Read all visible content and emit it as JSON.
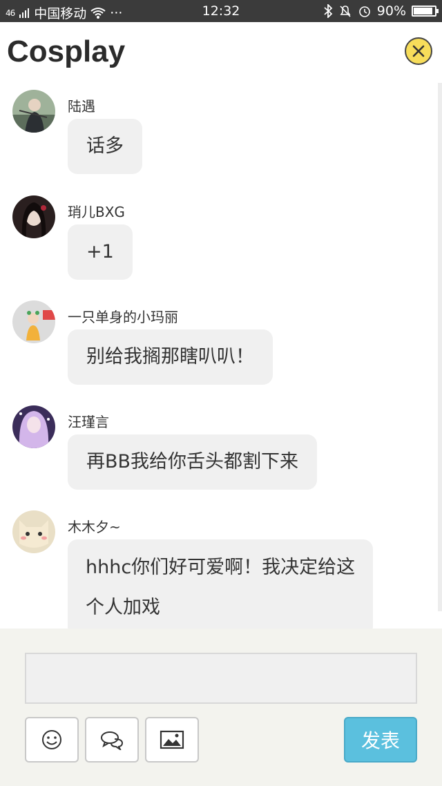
{
  "status_bar": {
    "network": "46",
    "carrier": "中国移动",
    "dots": "···",
    "time": "12:32",
    "battery": "90%",
    "battery_level": 0.9
  },
  "header": {
    "title": "Cosplay"
  },
  "messages": [
    {
      "user": "陆遇",
      "text": "话多",
      "avatar_color": "#6d7f6a"
    },
    {
      "user": "琑儿BXG",
      "text": "+1",
      "avatar_color": "#3a2a2a"
    },
    {
      "user": "一只单身的小玛丽",
      "text": "别给我搁那瞎叭叭！",
      "avatar_color": "#d9c7b3"
    },
    {
      "user": "汪瑾言",
      "text": "再BB我给你舌头都割下来",
      "avatar_color": "#b69bd4"
    },
    {
      "user": "木木夕~",
      "text_lines": [
        "hhhc你们好可爱啊！我决定给这",
        "个人加戏"
      ],
      "avatar_color": "#e8d9b5"
    }
  ],
  "composer": {
    "input_value": "",
    "send_label": "发表",
    "tools": [
      "emoji-icon",
      "chat-bubbles-icon",
      "image-icon"
    ]
  },
  "colors": {
    "close_button": "#f7dd5a",
    "send_button": "#5bc0de",
    "bubble": "#f0f0f0"
  }
}
